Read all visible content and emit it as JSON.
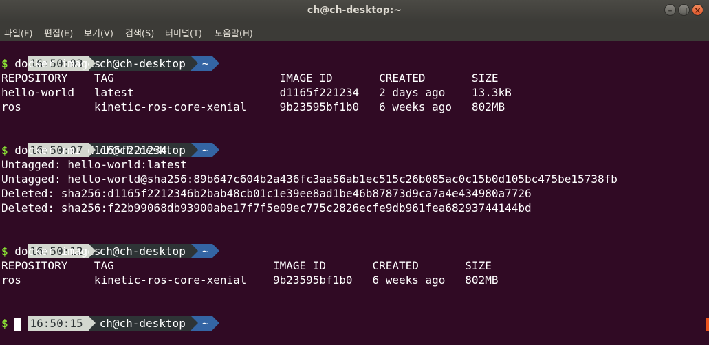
{
  "window": {
    "title": "ch@ch-desktop:~",
    "buttons": [
      "minimize",
      "maximize",
      "close"
    ]
  },
  "menu": [
    "파일(F)",
    "편집(E)",
    "보기(V)",
    "검색(S)",
    "터미널(T)",
    "도움말(H)"
  ],
  "prompt": {
    "host": "ch@ch-desktop",
    "dir": "~",
    "symbol": "$"
  },
  "blocks": [
    {
      "time": "16:50:03",
      "command": " docker images",
      "output": [
        "REPOSITORY    TAG                         IMAGE ID       CREATED       SIZE",
        "hello-world   latest                      d1165f221234   2 days ago    13.3kB",
        "ros           kinetic-ros-core-xenial     9b23595bf1b0   6 weeks ago   802MB"
      ]
    },
    {
      "time": "16:50:07",
      "command": " docker rmi d1165f221234",
      "output": [
        "Untagged: hello-world:latest",
        "Untagged: hello-world@sha256:89b647c604b2a436fc3aa56ab1ec515c26b085ac0c15b0d105bc475be15738fb",
        "Deleted: sha256:d1165f2212346b2bab48cb01c1e39ee8ad1be46b87873d9ca7a4e434980a7726",
        "Deleted: sha256:f22b99068db93900abe17f7f5e09ec775c2826ecfe9db961fea68293744144bd"
      ]
    },
    {
      "time": "16:50:12",
      "command": " docker images",
      "output": [
        "REPOSITORY    TAG                        IMAGE ID       CREATED       SIZE",
        "ros           kinetic-ros-core-xenial    9b23595bf1b0   6 weeks ago   802MB"
      ]
    },
    {
      "time": "16:50:15",
      "command": "",
      "output": []
    }
  ],
  "colors": {
    "background": "#300a24",
    "prompt_time_bg": "#d3d7cf",
    "prompt_host_bg": "#2e3436",
    "prompt_dir_bg": "#3465a4",
    "dollar": "#8ae234"
  }
}
